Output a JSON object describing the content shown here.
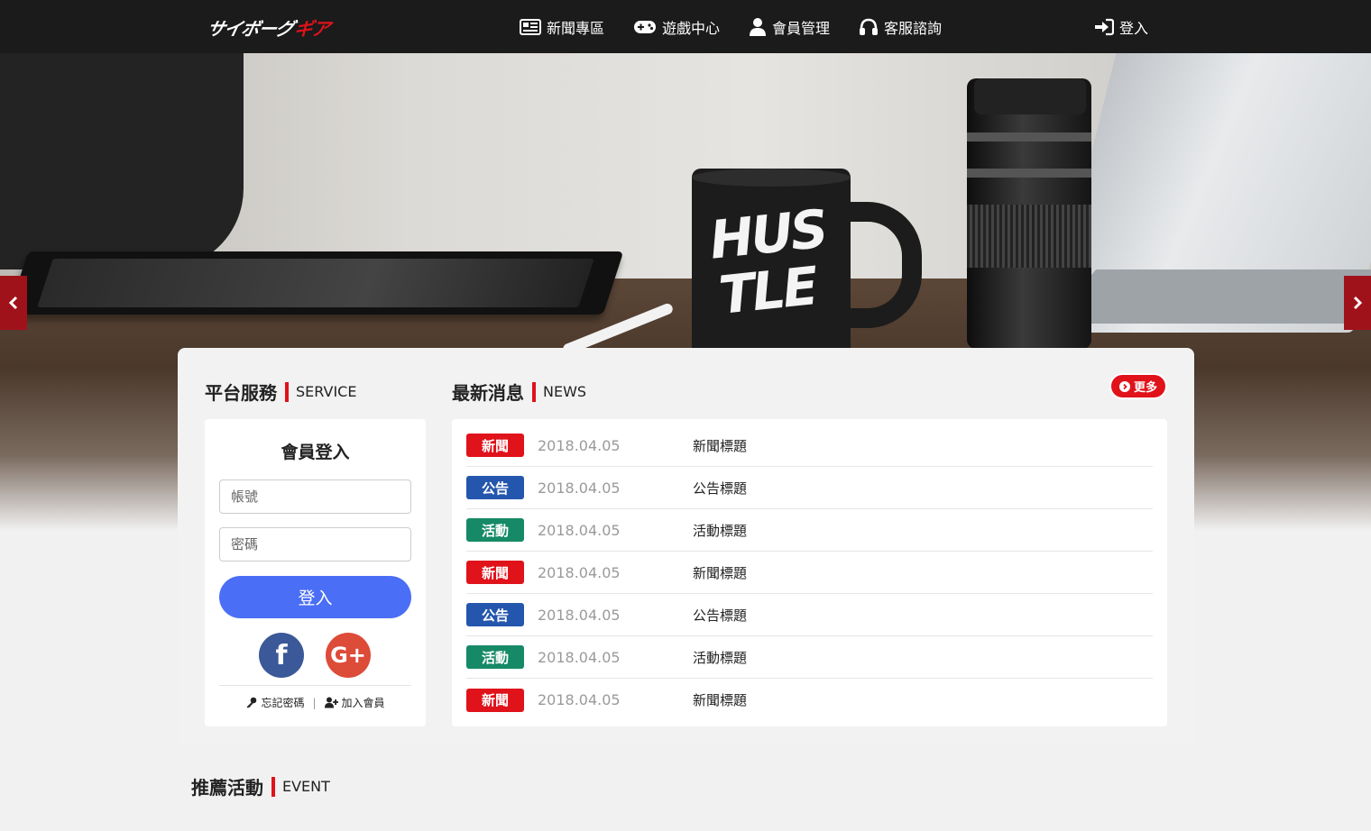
{
  "header": {
    "logo_main": "サイボーグ",
    "logo_accent": "ギア",
    "nav": [
      {
        "label": "新聞專區",
        "icon": "newspaper-icon"
      },
      {
        "label": "遊戲中心",
        "icon": "gamepad-icon"
      },
      {
        "label": "會員管理",
        "icon": "user-icon"
      },
      {
        "label": "客服諮詢",
        "icon": "headphones-icon"
      }
    ],
    "login_label": "登入"
  },
  "hero": {
    "mug_line1": "HUS",
    "mug_line2": "TLE",
    "accent_color": "#a0121a"
  },
  "service": {
    "title_zh": "平台服務",
    "title_en": "SERVICE",
    "login_title": "會員登入",
    "account_placeholder": "帳號",
    "password_placeholder": "密碼",
    "login_button": "登入",
    "facebook_label": "f",
    "google_label": "G+",
    "forgot_label": "忘記密碼",
    "separator": "|",
    "join_label": "加入會員"
  },
  "news": {
    "title_zh": "最新消息",
    "title_en": "NEWS",
    "more_label": "更多",
    "items": [
      {
        "tag": "新聞",
        "color": "#e0121a",
        "date": "2018.04.05",
        "title": "新聞標題"
      },
      {
        "tag": "公告",
        "color": "#2456ad",
        "date": "2018.04.05",
        "title": "公告標題"
      },
      {
        "tag": "活動",
        "color": "#168a66",
        "date": "2018.04.05",
        "title": "活動標題"
      },
      {
        "tag": "新聞",
        "color": "#e0121a",
        "date": "2018.04.05",
        "title": "新聞標題"
      },
      {
        "tag": "公告",
        "color": "#2456ad",
        "date": "2018.04.05",
        "title": "公告標題"
      },
      {
        "tag": "活動",
        "color": "#168a66",
        "date": "2018.04.05",
        "title": "活動標題"
      },
      {
        "tag": "新聞",
        "color": "#e0121a",
        "date": "2018.04.05",
        "title": "新聞標題"
      }
    ]
  },
  "event": {
    "title_zh": "推薦活動",
    "title_en": "EVENT"
  }
}
